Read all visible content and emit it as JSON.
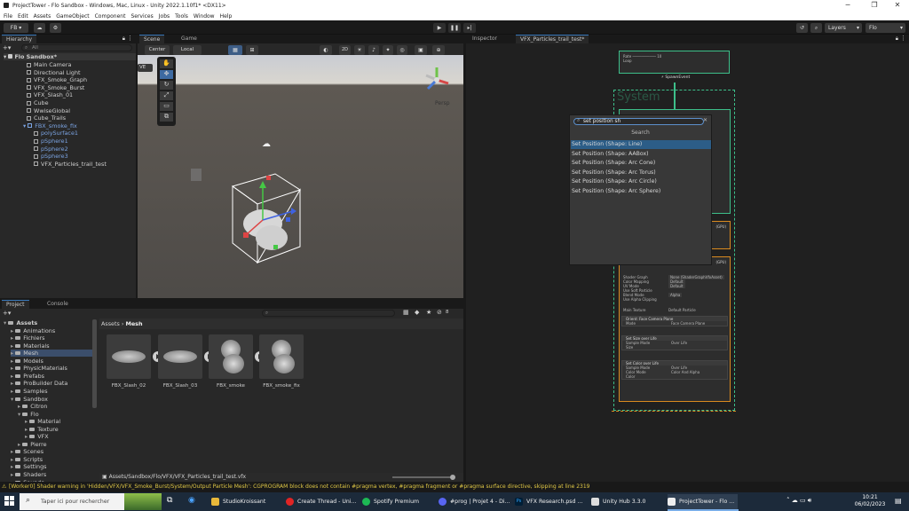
{
  "titlebar": {
    "title": "ProjectTower - Flo Sandbox - Windows, Mac, Linux - Unity 2022.1.10f1* <DX11>",
    "minimize": "─",
    "maximize": "❐",
    "close": "✕"
  },
  "menu": [
    "File",
    "Edit",
    "Assets",
    "GameObject",
    "Component",
    "Services",
    "Jobs",
    "Tools",
    "Window",
    "Help"
  ],
  "toolbar": {
    "account": "FB",
    "layers_label": "Layers",
    "layout_label": "Flo"
  },
  "hierarchy": {
    "tab": "Hierarchy",
    "search_placeholder": "All",
    "scene_name": "Flo Sandbox*",
    "items": [
      {
        "label": "Main Camera"
      },
      {
        "label": "Directional Light"
      },
      {
        "label": "VFX_Smoke_Graph"
      },
      {
        "label": "VFX_Smoke_Burst"
      },
      {
        "label": "VFX_Slash_01"
      },
      {
        "label": "Cube"
      },
      {
        "label": "WwiseGlobal"
      },
      {
        "label": "Cube_Trails"
      },
      {
        "label": "FBX_smoke_fix"
      },
      {
        "label": "polySurface1"
      },
      {
        "label": "pSphere1"
      },
      {
        "label": "pSphere2"
      },
      {
        "label": "pSphere3"
      },
      {
        "label": "VFX_Particles_trail_test"
      }
    ]
  },
  "scene": {
    "tabs": [
      "Scene",
      "Game"
    ],
    "pivot": "Center",
    "space": "Local",
    "mode_2d": "2D",
    "overlay_label": "VE",
    "persp_label": "Persp",
    "axis_labels": {
      "x": "x",
      "y": "y",
      "z": "z"
    }
  },
  "project": {
    "tabs": [
      "Project",
      "Console"
    ],
    "tree": [
      {
        "label": "Assets",
        "depth": 0
      },
      {
        "label": "Animations",
        "depth": 1
      },
      {
        "label": "Fichiers",
        "depth": 1
      },
      {
        "label": "Materials",
        "depth": 1
      },
      {
        "label": "Mesh",
        "depth": 1
      },
      {
        "label": "Models",
        "depth": 1
      },
      {
        "label": "PhysicMaterials",
        "depth": 1
      },
      {
        "label": "Prefabs",
        "depth": 1
      },
      {
        "label": "ProBuilder Data",
        "depth": 1
      },
      {
        "label": "Samples",
        "depth": 1
      },
      {
        "label": "Sandbox",
        "depth": 1
      },
      {
        "label": "Citron",
        "depth": 2
      },
      {
        "label": "Flo",
        "depth": 2
      },
      {
        "label": "Material",
        "depth": 3
      },
      {
        "label": "Texture",
        "depth": 3
      },
      {
        "label": "VFX",
        "depth": 3
      },
      {
        "label": "Pierre",
        "depth": 2
      },
      {
        "label": "Scenes",
        "depth": 1
      },
      {
        "label": "Scripts",
        "depth": 1
      },
      {
        "label": "Settings",
        "depth": 1
      },
      {
        "label": "Shaders",
        "depth": 1
      },
      {
        "label": "Sounds",
        "depth": 1
      }
    ],
    "breadcrumb": [
      "Assets",
      "Mesh"
    ],
    "assets": [
      "FBX_Slash_02",
      "FBX_Slash_03",
      "FBX_smoke",
      "FBX_smoke_fix"
    ],
    "path": "Assets/Sandbox/Flo/VFX/VFX_Particles_trail_test.vfx",
    "hidden_count": "8"
  },
  "inspector": {
    "tabs": [
      "Inspector",
      "VFX_Particles_trail_test*"
    ]
  },
  "vfx": {
    "system_label": "System",
    "spawn_event": "SpawnEvent",
    "search_value": "set position sh",
    "search_header": "Search",
    "results": [
      "Set Position (Shape: Line)",
      "Set Position (Shape: AABox)",
      "Set Position (Shape: Arc Cone)",
      "Set Position (Shape: Arc Torus)",
      "Set Position (Shape: Arc Circle)",
      "Set Position (Shape: Arc Sphere)"
    ],
    "output_rows": [
      "Shader Graph",
      "Color Mapping",
      "UV Mode",
      "Use Soft Particle",
      "Blend Mode",
      "Use Alpha Clipping"
    ],
    "output_values": [
      "None (ShaderGraphVfxAsset)",
      "Default",
      "Default",
      "",
      "Alpha",
      ""
    ],
    "main_texture": "Main Texture",
    "main_texture_value": "Default Particle",
    "blocks": [
      {
        "title": "Orient: Face Camera Plane",
        "rows": [
          "Mode"
        ],
        "values": [
          "Face Camera Plane"
        ]
      },
      {
        "title": "Set Size over Life",
        "rows": [
          "Sample Mode",
          "Size"
        ],
        "values": [
          "Over Life",
          ""
        ]
      },
      {
        "title": "Set Color over Life",
        "rows": [
          "Sample Mode",
          "Color Mode",
          "Color"
        ],
        "values": [
          "Over Life",
          "Color And Alpha",
          ""
        ]
      }
    ],
    "gpu_badge": "(GPU)",
    "colors": {
      "green": "#3dbf8a",
      "orange": "#d98a1f",
      "accent": "#3a79bb"
    }
  },
  "status_message": "[Worker0] Shader warning in 'Hidden/VFX/VFX_Smoke_Burst/System/Output Particle Mesh': CGPROGRAM block does not contain #pragma vertex, #pragma fragment or #pragma surface directive, skipping at line 2319",
  "taskbar": {
    "search_placeholder": "Taper ici pour rechercher",
    "tasks": [
      "StudioKroissant",
      "Create Thread - Uni...",
      "Spotify Premium",
      "#prog | Projet 4 - Di...",
      "VFX Research.psd ...",
      "Unity Hub 3.3.0",
      "ProjectTower - Flo ..."
    ],
    "time": "10:21",
    "date": "06/02/2023"
  }
}
